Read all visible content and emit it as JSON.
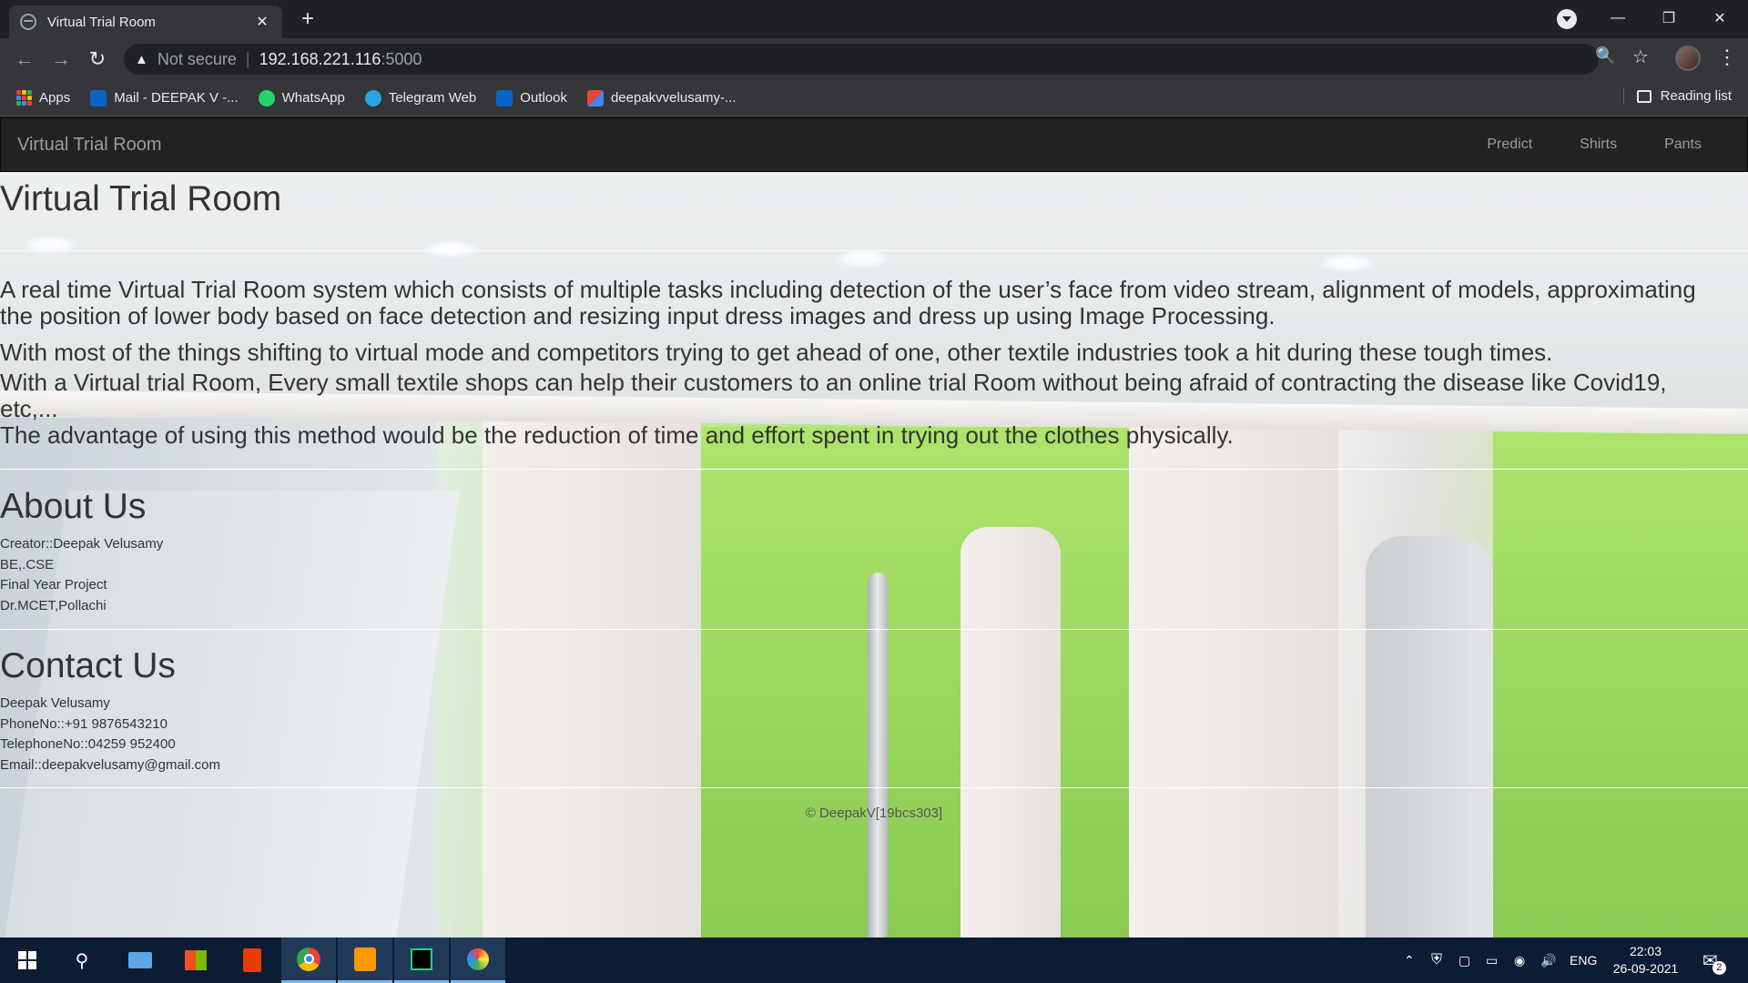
{
  "browser": {
    "tab_title": "Virtual Trial Room",
    "tab_close": "✕",
    "new_tab": "+",
    "address": {
      "security_label": "Not secure",
      "host": "192.168.221.116",
      "port": ":5000"
    },
    "bookmarks": [
      {
        "label": "Apps",
        "icon": "apps-grid-icon"
      },
      {
        "label": "Mail - DEEPAK V -...",
        "icon": "outlook-icon"
      },
      {
        "label": "WhatsApp",
        "icon": "whatsapp-icon"
      },
      {
        "label": "Telegram Web",
        "icon": "telegram-icon"
      },
      {
        "label": "Outlook",
        "icon": "outlook-icon"
      },
      {
        "label": "deepakvvelusamy-...",
        "icon": "gmail-icon"
      }
    ],
    "reading_list": "Reading list"
  },
  "site": {
    "brand": "Virtual Trial Room",
    "nav": [
      {
        "label": "Predict"
      },
      {
        "label": "Shirts"
      },
      {
        "label": "Pants"
      }
    ],
    "hero_title": "Virtual Trial Room",
    "paragraphs": [
      "A real time Virtual Trial Room system which consists of multiple tasks including detection of the user’s face from video stream, alignment of models, approximating the position of lower body based on face detection and resizing input dress images and dress up using Image Processing.",
      "With most of the things shifting to virtual mode and competitors trying to get ahead of one, other textile industries took a hit during these tough times.",
      "With a Virtual trial Room, Every small textile shops can help their customers to an online trial Room without being afraid of contracting the disease like Covid19, etc,...",
      "The advantage of using this method would be the reduction of time and effort spent in trying out the clothes physically."
    ],
    "about": {
      "title": "About Us",
      "lines": [
        "Creator::Deepak Velusamy",
        "BE,.CSE",
        "Final Year Project",
        "Dr.MCET,Pollachi"
      ]
    },
    "contact": {
      "title": "Contact Us",
      "lines": [
        "Deepak Velusamy",
        "PhoneNo::+91 9876543210",
        "TelephoneNo::04259 952400",
        "Email::deepakvelusamy@gmail.com"
      ]
    },
    "footer": "© DeepakV[19bcs303]"
  },
  "taskbar": {
    "language": "ENG",
    "time": "22:03",
    "date": "26-09-2021",
    "notification_count": "2"
  },
  "colors": {
    "navbar_bg": "#222222",
    "nav_text": "#9d9d9d",
    "taskbar_bg": "#0b1c33"
  }
}
